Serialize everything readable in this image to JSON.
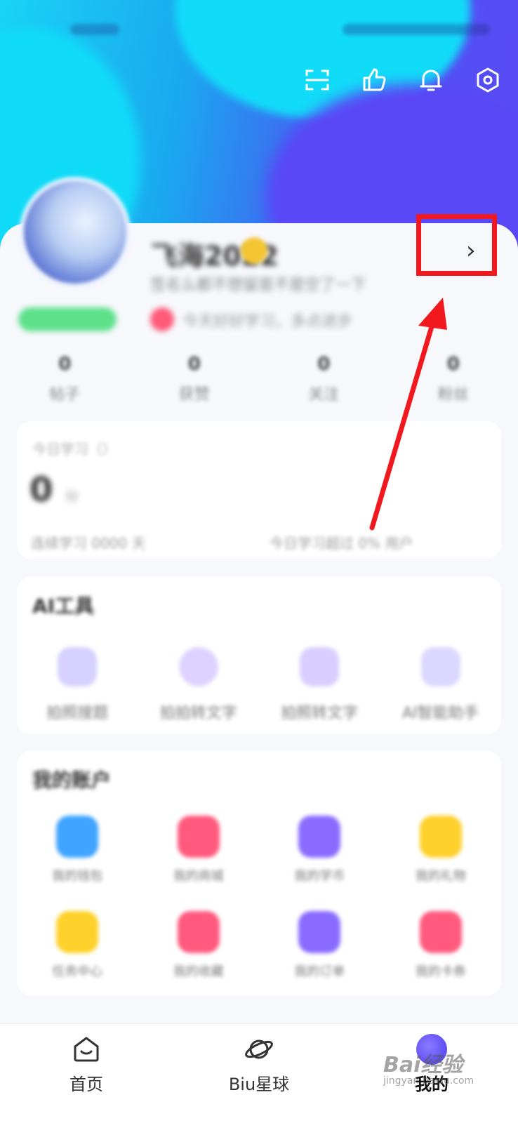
{
  "top_icons": [
    "scan-icon",
    "thumbs-up-icon",
    "bell-icon",
    "settings-hexagon-icon"
  ],
  "profile": {
    "nickname": "飞海2022",
    "bio": "签名么都不想留是不是空了一下",
    "chevron": "›",
    "tag_text": "今天好好学习，多点进步"
  },
  "stats": [
    {
      "n": "0",
      "l": "帖子"
    },
    {
      "n": "0",
      "l": "获赞"
    },
    {
      "n": "0",
      "l": "关注"
    },
    {
      "n": "0",
      "l": "粉丝"
    }
  ],
  "study": {
    "title": "今日学习（）",
    "zero": "0",
    "unit": "分",
    "left_footer": "连续学习 0000 天",
    "right_footer": "今日学习超过 0% 用户"
  },
  "ai_tools": {
    "title": "AI工具",
    "items": [
      {
        "label": "拍照搜题",
        "color": "#b9b1ff"
      },
      {
        "label": "拍拍转文字",
        "color": "#c9b8ff"
      },
      {
        "label": "拍照转文字",
        "color": "#c2b2ff"
      },
      {
        "label": "AI智能助手",
        "color": "#c6c1ff"
      }
    ]
  },
  "account": {
    "title": "我的账户",
    "row1": [
      {
        "label": "我的钱包",
        "color": "#3fa4ff"
      },
      {
        "label": "我的商城",
        "color": "#ff5a7e"
      },
      {
        "label": "我的学币",
        "color": "#8a6bff"
      },
      {
        "label": "我的礼物",
        "color": "#ffd12c"
      }
    ],
    "row2": [
      {
        "label": "任务中心",
        "color": "#ffd12c"
      },
      {
        "label": "我的收藏",
        "color": "#ff5a7e"
      },
      {
        "label": "我的订单",
        "color": "#8a6bff"
      },
      {
        "label": "我的卡券",
        "color": "#ff5a7e"
      }
    ]
  },
  "tabbar": [
    {
      "label": "首页",
      "icon": "home-icon"
    },
    {
      "label": "Biu星球",
      "icon": "planet-icon"
    },
    {
      "label": "我的",
      "icon": "me-icon"
    }
  ],
  "watermark": "Bai经验",
  "watermark_sub": "jingyan.baidu.com",
  "colors": {
    "highlight": "#f1191e",
    "arrow": "#f1191e"
  }
}
